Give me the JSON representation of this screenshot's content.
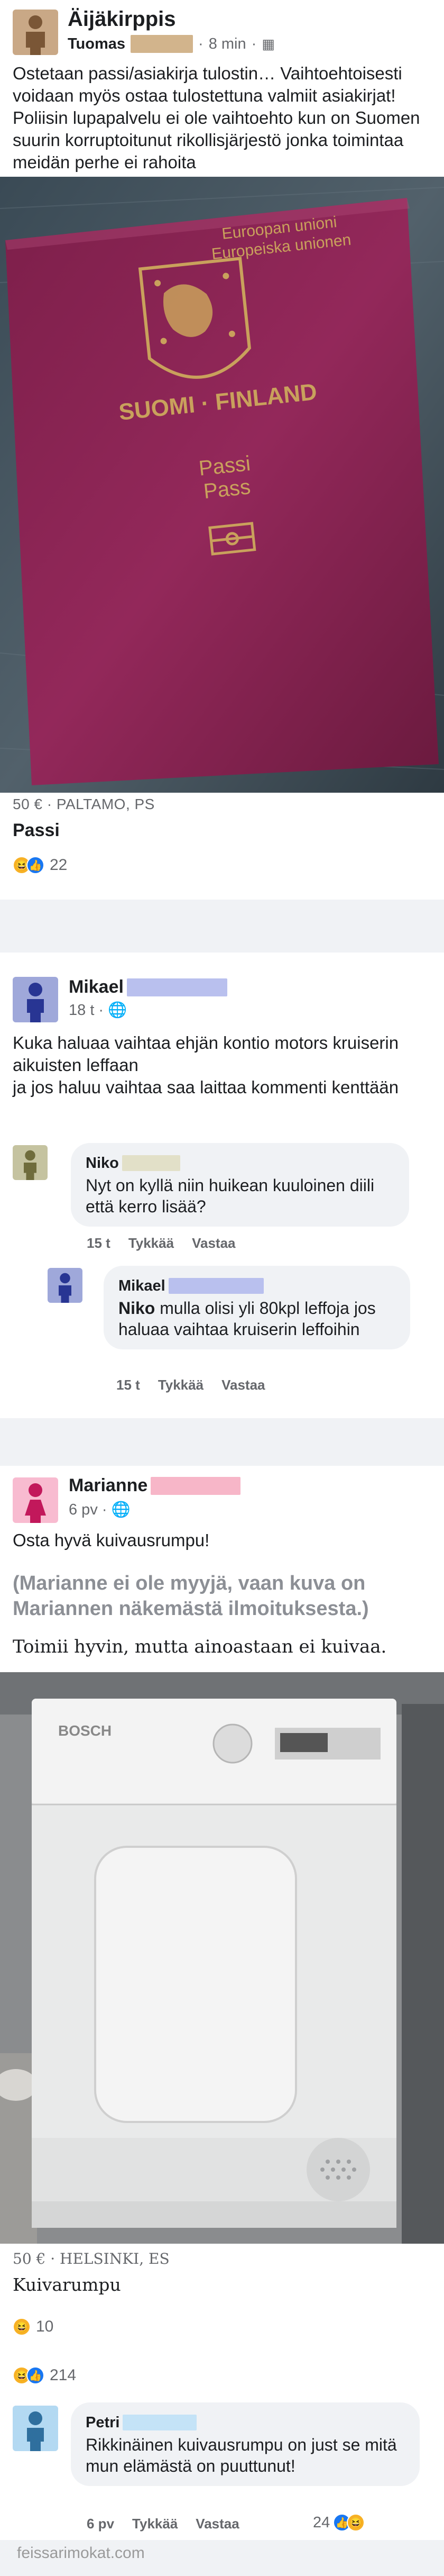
{
  "post1": {
    "group_name": "Äijäkirppis",
    "author": "Tuomas",
    "time": "8 min",
    "text": "Ostetaan passi/asiakirja tulostin… Vaihtoehtoisesti voidaan myös ostaa tulostettuna valmiit asiakirjat! Poliisin lupapalvelu ei ole vaihtoehto kun on Suomen suurin korruptoitunut rikollisjärjestö jonka toimintaa meidän perhe ei rahoita",
    "photo": {
      "line1": "Euroopan unioni",
      "line2": "Europeiska unionen",
      "country": "SUOMI · FINLAND",
      "doc1": "Passi",
      "doc2": "Pass"
    },
    "price_location": "50 € · PALTAMO, PS",
    "item_title": "Passi",
    "reaction_count": "22"
  },
  "post2": {
    "author": "Mikael",
    "time": "18 t",
    "text": "Kuka haluaa vaihtaa ehjän kontio motors kruiserin aikuisten leffaan\nja jos haluu vaihtaa saa laittaa kommenti kenttään",
    "comment1": {
      "author": "Niko",
      "text": "Nyt on kyllä niin huikean kuuloinen diili että kerro lisää?",
      "time": "15 t",
      "like": "Tykkää",
      "reply": "Vastaa"
    },
    "comment2": {
      "author": "Mikael",
      "mention": "Niko",
      "text": "mulla olisi yli 80kpl leffoja jos haluaa vaihtaa kruiserin leffoihin",
      "time": "15 t",
      "like": "Tykkää",
      "reply": "Vastaa"
    }
  },
  "post3": {
    "author": "Marianne",
    "time": "6 pv",
    "text": "Osta hyvä kuivausrumpu!",
    "note": "(Marianne ei ole myyjä, vaan kuva on Mariannen näkemästä ilmoituksesta.)",
    "caption": "Toimii hyvin, mutta ainoastaan ei kuivaa.",
    "photo": {
      "brand": "BOSCH"
    },
    "price_location": "50 € · HELSINKI, ES",
    "item_title": "Kuivarumpu",
    "reaction_count_1": "10",
    "reaction_count_2": "214",
    "comment": {
      "author": "Petri",
      "text": "Rikkinäinen kuivausrumpu on just se mitä mun elämästä on puuttunut!",
      "time": "6 pv",
      "like": "Tykkää",
      "reply": "Vastaa",
      "reaction_count": "24"
    }
  },
  "footer": "feissarimokat.com",
  "colors": {
    "male_avatar": "#9fa8da",
    "female_avatar": "#f8bbd0",
    "brown_avatar": "#c9a886",
    "olive_avatar": "#c5c3a0",
    "blue_avatar": "#b3d9f2",
    "redaction_brown": "#d2b48c",
    "redaction_blue": "#b9c0ee",
    "redaction_pink": "#f7b6c8",
    "redaction_olive": "#e2e0c8",
    "redaction_lightblue": "#c4e3f7"
  }
}
